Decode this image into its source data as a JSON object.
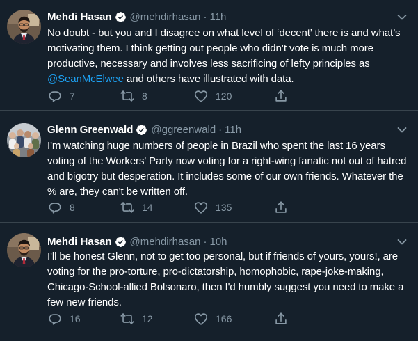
{
  "colors": {
    "background": "#15202b",
    "divider": "#38444d",
    "text_primary": "#ffffff",
    "text_secondary": "#8899a6",
    "link": "#1da1f2",
    "verified_badge": "#ffffff"
  },
  "icons": {
    "verified": "verified-badge-icon",
    "more": "chevron-down-icon",
    "reply": "reply-icon",
    "retweet": "retweet-icon",
    "like": "heart-icon",
    "share": "share-icon"
  },
  "tweets": [
    {
      "name": "Mehdi Hasan",
      "handle": "@mehdirhasan",
      "separator": "·",
      "time": "11h",
      "text_before_mention": "No doubt - but you and I disagree on what level of ‘decent’ there is and what’s motivating them. I think getting out people who didn’t vote is much more productive, necessary and involves less sacrificing of lefty principles as ",
      "mention": "@SeanMcElwee",
      "text_after_mention": " and others have illustrated with data.",
      "reply_count": "7",
      "retweet_count": "8",
      "like_count": "120"
    },
    {
      "name": "Glenn Greenwald",
      "handle": "@ggreenwald",
      "separator": "·",
      "time": "11h",
      "text": "I'm watching huge numbers of people in Brazil who spent the last 16 years voting of the Workers' Party now voting for a right-wing fanatic not out of hatred and bigotry but desperation. It includes some of our own friends. Whatever the % are, they can't be written off.",
      "reply_count": "8",
      "retweet_count": "14",
      "like_count": "135"
    },
    {
      "name": "Mehdi Hasan",
      "handle": "@mehdirhasan",
      "separator": "·",
      "time": "10h",
      "text": "I'll be honest Glenn, not to get too personal, but if friends of yours, yours!, are voting for the pro-torture, pro-dictatorship, homophobic, rape-joke-making, Chicago-School-allied Bolsonaro, then I'd humbly suggest you need to make a few new friends.",
      "reply_count": "16",
      "retweet_count": "12",
      "like_count": "166"
    }
  ]
}
